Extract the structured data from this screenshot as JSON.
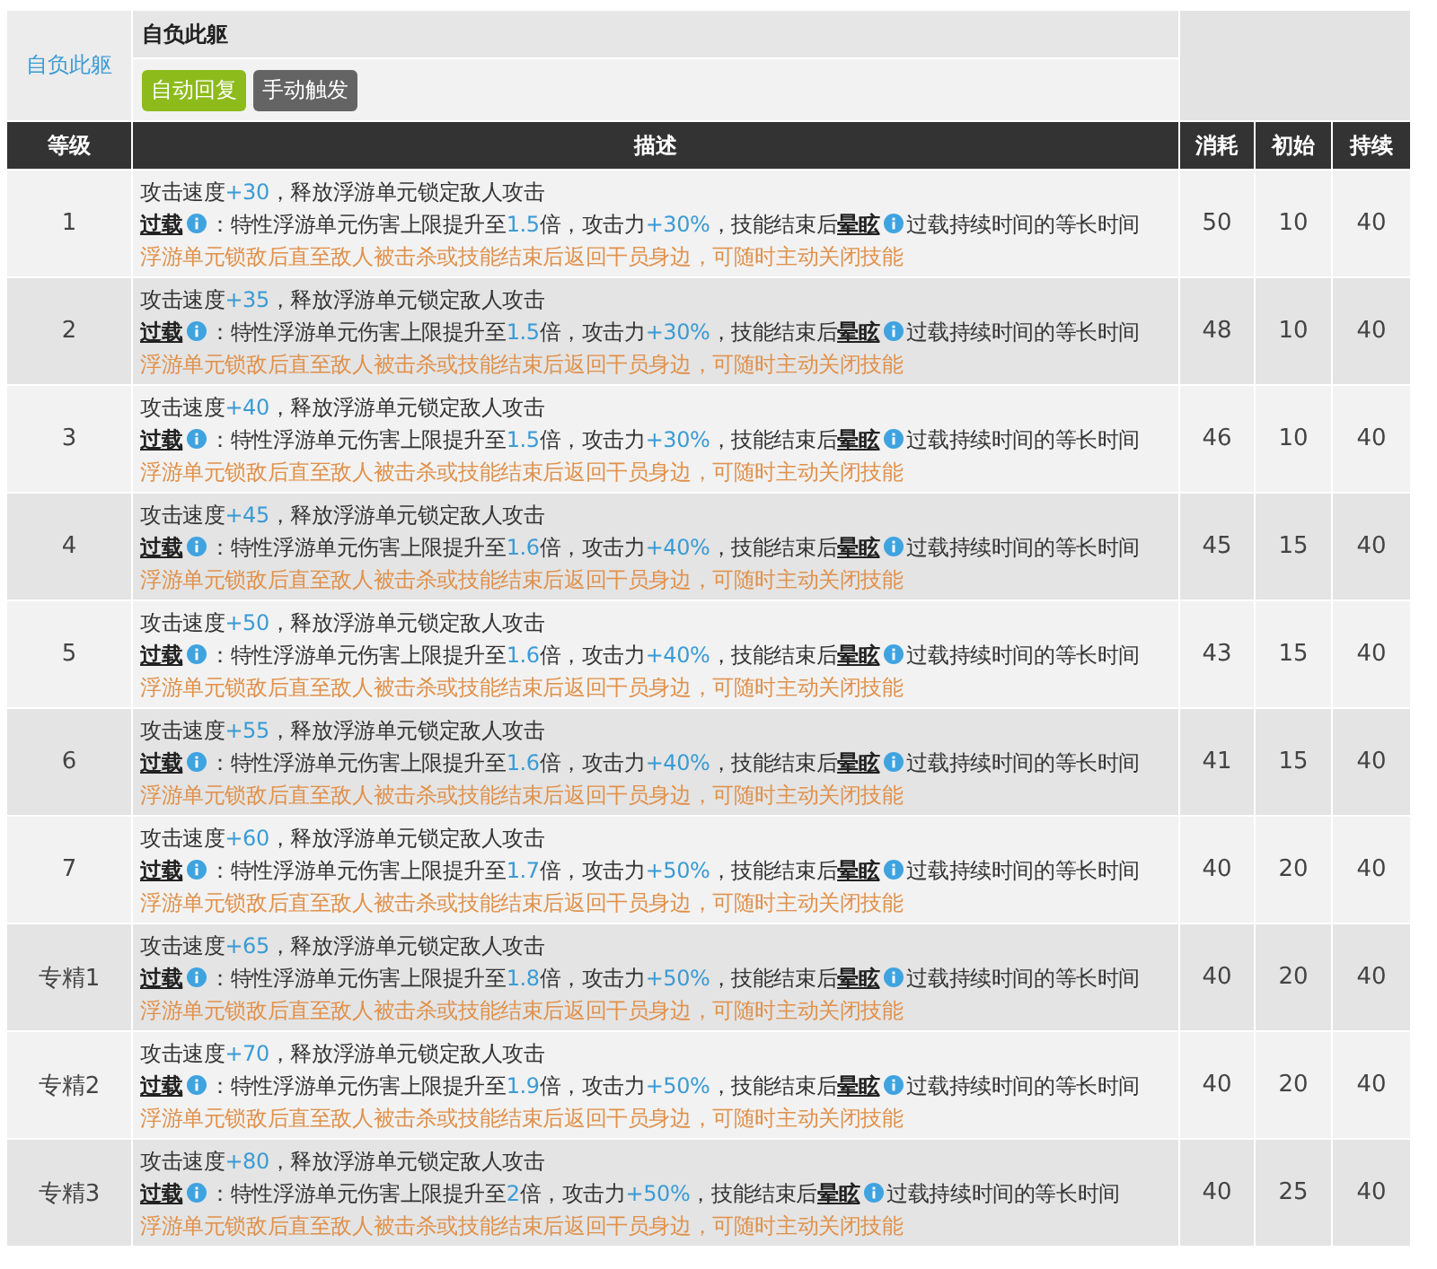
{
  "skill": {
    "side_label": "自负此躯",
    "name": "自负此躯",
    "tags": [
      {
        "label": "自动回复",
        "color": "#8dbb1c"
      },
      {
        "label": "手动触发",
        "color": "#646464"
      }
    ]
  },
  "table": {
    "columns": [
      "等级",
      "描述",
      "消耗",
      "初始",
      "持续"
    ],
    "rows": [
      {
        "level": "1",
        "cost": "50",
        "initial": "10",
        "duration": "40",
        "lines": [
          {
            "kind": "main",
            "segments": [
              {
                "kind": "plain",
                "text": "攻击速度"
              },
              {
                "kind": "value",
                "text": "+30"
              },
              {
                "kind": "plain",
                "text": "，释放浮游单元锁定敌人攻击"
              }
            ]
          },
          {
            "kind": "main",
            "segments": [
              {
                "kind": "term",
                "text": "过载"
              },
              {
                "kind": "plain",
                "text": "：特性浮游单元伤害上限提升至"
              },
              {
                "kind": "value",
                "text": "1.5"
              },
              {
                "kind": "plain",
                "text": "倍，攻击力"
              },
              {
                "kind": "value",
                "text": "+30%"
              },
              {
                "kind": "plain",
                "text": "，技能结束后"
              },
              {
                "kind": "term",
                "text": "晕眩"
              },
              {
                "kind": "plain",
                "text": "过载持续时间的等长时间"
              }
            ]
          },
          {
            "kind": "note",
            "segments": [
              {
                "kind": "plain",
                "text": "浮游单元锁敌后直至敌人被击杀或技能结束后返回干员身边，可随时主动关闭技能"
              }
            ]
          }
        ]
      },
      {
        "level": "2",
        "cost": "48",
        "initial": "10",
        "duration": "40",
        "lines": [
          {
            "kind": "main",
            "segments": [
              {
                "kind": "plain",
                "text": "攻击速度"
              },
              {
                "kind": "value",
                "text": "+35"
              },
              {
                "kind": "plain",
                "text": "，释放浮游单元锁定敌人攻击"
              }
            ]
          },
          {
            "kind": "main",
            "segments": [
              {
                "kind": "term",
                "text": "过载"
              },
              {
                "kind": "plain",
                "text": "：特性浮游单元伤害上限提升至"
              },
              {
                "kind": "value",
                "text": "1.5"
              },
              {
                "kind": "plain",
                "text": "倍，攻击力"
              },
              {
                "kind": "value",
                "text": "+30%"
              },
              {
                "kind": "plain",
                "text": "，技能结束后"
              },
              {
                "kind": "term",
                "text": "晕眩"
              },
              {
                "kind": "plain",
                "text": "过载持续时间的等长时间"
              }
            ]
          },
          {
            "kind": "note",
            "segments": [
              {
                "kind": "plain",
                "text": "浮游单元锁敌后直至敌人被击杀或技能结束后返回干员身边，可随时主动关闭技能"
              }
            ]
          }
        ]
      },
      {
        "level": "3",
        "cost": "46",
        "initial": "10",
        "duration": "40",
        "lines": [
          {
            "kind": "main",
            "segments": [
              {
                "kind": "plain",
                "text": "攻击速度"
              },
              {
                "kind": "value",
                "text": "+40"
              },
              {
                "kind": "plain",
                "text": "，释放浮游单元锁定敌人攻击"
              }
            ]
          },
          {
            "kind": "main",
            "segments": [
              {
                "kind": "term",
                "text": "过载"
              },
              {
                "kind": "plain",
                "text": "：特性浮游单元伤害上限提升至"
              },
              {
                "kind": "value",
                "text": "1.5"
              },
              {
                "kind": "plain",
                "text": "倍，攻击力"
              },
              {
                "kind": "value",
                "text": "+30%"
              },
              {
                "kind": "plain",
                "text": "，技能结束后"
              },
              {
                "kind": "term",
                "text": "晕眩"
              },
              {
                "kind": "plain",
                "text": "过载持续时间的等长时间"
              }
            ]
          },
          {
            "kind": "note",
            "segments": [
              {
                "kind": "plain",
                "text": "浮游单元锁敌后直至敌人被击杀或技能结束后返回干员身边，可随时主动关闭技能"
              }
            ]
          }
        ]
      },
      {
        "level": "4",
        "cost": "45",
        "initial": "15",
        "duration": "40",
        "lines": [
          {
            "kind": "main",
            "segments": [
              {
                "kind": "plain",
                "text": "攻击速度"
              },
              {
                "kind": "value",
                "text": "+45"
              },
              {
                "kind": "plain",
                "text": "，释放浮游单元锁定敌人攻击"
              }
            ]
          },
          {
            "kind": "main",
            "segments": [
              {
                "kind": "term",
                "text": "过载"
              },
              {
                "kind": "plain",
                "text": "：特性浮游单元伤害上限提升至"
              },
              {
                "kind": "value",
                "text": "1.6"
              },
              {
                "kind": "plain",
                "text": "倍，攻击力"
              },
              {
                "kind": "value",
                "text": "+40%"
              },
              {
                "kind": "plain",
                "text": "，技能结束后"
              },
              {
                "kind": "term",
                "text": "晕眩"
              },
              {
                "kind": "plain",
                "text": "过载持续时间的等长时间"
              }
            ]
          },
          {
            "kind": "note",
            "segments": [
              {
                "kind": "plain",
                "text": "浮游单元锁敌后直至敌人被击杀或技能结束后返回干员身边，可随时主动关闭技能"
              }
            ]
          }
        ]
      },
      {
        "level": "5",
        "cost": "43",
        "initial": "15",
        "duration": "40",
        "lines": [
          {
            "kind": "main",
            "segments": [
              {
                "kind": "plain",
                "text": "攻击速度"
              },
              {
                "kind": "value",
                "text": "+50"
              },
              {
                "kind": "plain",
                "text": "，释放浮游单元锁定敌人攻击"
              }
            ]
          },
          {
            "kind": "main",
            "segments": [
              {
                "kind": "term",
                "text": "过载"
              },
              {
                "kind": "plain",
                "text": "：特性浮游单元伤害上限提升至"
              },
              {
                "kind": "value",
                "text": "1.6"
              },
              {
                "kind": "plain",
                "text": "倍，攻击力"
              },
              {
                "kind": "value",
                "text": "+40%"
              },
              {
                "kind": "plain",
                "text": "，技能结束后"
              },
              {
                "kind": "term",
                "text": "晕眩"
              },
              {
                "kind": "plain",
                "text": "过载持续时间的等长时间"
              }
            ]
          },
          {
            "kind": "note",
            "segments": [
              {
                "kind": "plain",
                "text": "浮游单元锁敌后直至敌人被击杀或技能结束后返回干员身边，可随时主动关闭技能"
              }
            ]
          }
        ]
      },
      {
        "level": "6",
        "cost": "41",
        "initial": "15",
        "duration": "40",
        "lines": [
          {
            "kind": "main",
            "segments": [
              {
                "kind": "plain",
                "text": "攻击速度"
              },
              {
                "kind": "value",
                "text": "+55"
              },
              {
                "kind": "plain",
                "text": "，释放浮游单元锁定敌人攻击"
              }
            ]
          },
          {
            "kind": "main",
            "segments": [
              {
                "kind": "term",
                "text": "过载"
              },
              {
                "kind": "plain",
                "text": "：特性浮游单元伤害上限提升至"
              },
              {
                "kind": "value",
                "text": "1.6"
              },
              {
                "kind": "plain",
                "text": "倍，攻击力"
              },
              {
                "kind": "value",
                "text": "+40%"
              },
              {
                "kind": "plain",
                "text": "，技能结束后"
              },
              {
                "kind": "term",
                "text": "晕眩"
              },
              {
                "kind": "plain",
                "text": "过载持续时间的等长时间"
              }
            ]
          },
          {
            "kind": "note",
            "segments": [
              {
                "kind": "plain",
                "text": "浮游单元锁敌后直至敌人被击杀或技能结束后返回干员身边，可随时主动关闭技能"
              }
            ]
          }
        ]
      },
      {
        "level": "7",
        "cost": "40",
        "initial": "20",
        "duration": "40",
        "lines": [
          {
            "kind": "main",
            "segments": [
              {
                "kind": "plain",
                "text": "攻击速度"
              },
              {
                "kind": "value",
                "text": "+60"
              },
              {
                "kind": "plain",
                "text": "，释放浮游单元锁定敌人攻击"
              }
            ]
          },
          {
            "kind": "main",
            "segments": [
              {
                "kind": "term",
                "text": "过载"
              },
              {
                "kind": "plain",
                "text": "：特性浮游单元伤害上限提升至"
              },
              {
                "kind": "value",
                "text": "1.7"
              },
              {
                "kind": "plain",
                "text": "倍，攻击力"
              },
              {
                "kind": "value",
                "text": "+50%"
              },
              {
                "kind": "plain",
                "text": "，技能结束后"
              },
              {
                "kind": "term",
                "text": "晕眩"
              },
              {
                "kind": "plain",
                "text": "过载持续时间的等长时间"
              }
            ]
          },
          {
            "kind": "note",
            "segments": [
              {
                "kind": "plain",
                "text": "浮游单元锁敌后直至敌人被击杀或技能结束后返回干员身边，可随时主动关闭技能"
              }
            ]
          }
        ]
      },
      {
        "level": "专精1",
        "cost": "40",
        "initial": "20",
        "duration": "40",
        "lines": [
          {
            "kind": "main",
            "segments": [
              {
                "kind": "plain",
                "text": "攻击速度"
              },
              {
                "kind": "value",
                "text": "+65"
              },
              {
                "kind": "plain",
                "text": "，释放浮游单元锁定敌人攻击"
              }
            ]
          },
          {
            "kind": "main",
            "segments": [
              {
                "kind": "term",
                "text": "过载"
              },
              {
                "kind": "plain",
                "text": "：特性浮游单元伤害上限提升至"
              },
              {
                "kind": "value",
                "text": "1.8"
              },
              {
                "kind": "plain",
                "text": "倍，攻击力"
              },
              {
                "kind": "value",
                "text": "+50%"
              },
              {
                "kind": "plain",
                "text": "，技能结束后"
              },
              {
                "kind": "term",
                "text": "晕眩"
              },
              {
                "kind": "plain",
                "text": "过载持续时间的等长时间"
              }
            ]
          },
          {
            "kind": "note",
            "segments": [
              {
                "kind": "plain",
                "text": "浮游单元锁敌后直至敌人被击杀或技能结束后返回干员身边，可随时主动关闭技能"
              }
            ]
          }
        ]
      },
      {
        "level": "专精2",
        "cost": "40",
        "initial": "20",
        "duration": "40",
        "lines": [
          {
            "kind": "main",
            "segments": [
              {
                "kind": "plain",
                "text": "攻击速度"
              },
              {
                "kind": "value",
                "text": "+70"
              },
              {
                "kind": "plain",
                "text": "，释放浮游单元锁定敌人攻击"
              }
            ]
          },
          {
            "kind": "main",
            "segments": [
              {
                "kind": "term",
                "text": "过载"
              },
              {
                "kind": "plain",
                "text": "：特性浮游单元伤害上限提升至"
              },
              {
                "kind": "value",
                "text": "1.9"
              },
              {
                "kind": "plain",
                "text": "倍，攻击力"
              },
              {
                "kind": "value",
                "text": "+50%"
              },
              {
                "kind": "plain",
                "text": "，技能结束后"
              },
              {
                "kind": "term",
                "text": "晕眩"
              },
              {
                "kind": "plain",
                "text": "过载持续时间的等长时间"
              }
            ]
          },
          {
            "kind": "note",
            "segments": [
              {
                "kind": "plain",
                "text": "浮游单元锁敌后直至敌人被击杀或技能结束后返回干员身边，可随时主动关闭技能"
              }
            ]
          }
        ]
      },
      {
        "level": "专精3",
        "cost": "40",
        "initial": "25",
        "duration": "40",
        "lines": [
          {
            "kind": "main",
            "segments": [
              {
                "kind": "plain",
                "text": "攻击速度"
              },
              {
                "kind": "value",
                "text": "+80"
              },
              {
                "kind": "plain",
                "text": "，释放浮游单元锁定敌人攻击"
              }
            ]
          },
          {
            "kind": "main",
            "segments": [
              {
                "kind": "term",
                "text": "过载"
              },
              {
                "kind": "plain",
                "text": "：特性浮游单元伤害上限提升至"
              },
              {
                "kind": "value",
                "text": "2"
              },
              {
                "kind": "plain",
                "text": "倍，攻击力"
              },
              {
                "kind": "value",
                "text": "+50%"
              },
              {
                "kind": "plain",
                "text": "，技能结束后"
              },
              {
                "kind": "term",
                "text": "晕眩"
              },
              {
                "kind": "plain",
                "text": "过载持续时间的等长时间"
              }
            ]
          },
          {
            "kind": "note",
            "segments": [
              {
                "kind": "plain",
                "text": "浮游单元锁敌后直至敌人被击杀或技能结束后返回干员身边，可随时主动关闭技能"
              }
            ]
          }
        ]
      }
    ]
  }
}
